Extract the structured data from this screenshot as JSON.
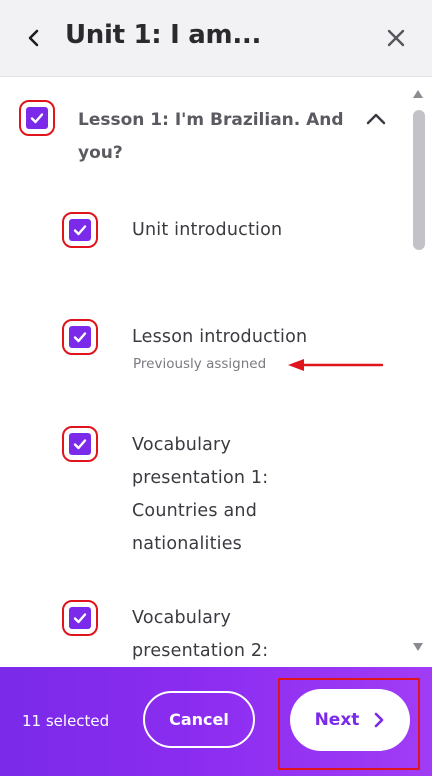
{
  "header": {
    "title": "Unit 1: I am...",
    "back_icon": "chevron-left-icon",
    "close_icon": "close-icon"
  },
  "lesson": {
    "label": "Lesson 1: I'm Brazilian. And you?",
    "checked": true,
    "expanded": true
  },
  "items": [
    {
      "label": "Unit introduction",
      "checked": true,
      "note": ""
    },
    {
      "label": "Lesson introduction",
      "checked": true,
      "note": "Previously assigned"
    },
    {
      "label": "Vocabulary presentation 1: Countries and nationalities",
      "checked": true,
      "note": ""
    },
    {
      "label": "Vocabulary presentation 2:",
      "checked": true,
      "note": ""
    }
  ],
  "footer": {
    "selected_count": "11 selected",
    "cancel_label": "Cancel",
    "next_label": "Next"
  },
  "colors": {
    "accent": "#7a2ae8",
    "annotation_red": "#e0141c",
    "footer_gradient_end": "#a13cf6"
  }
}
